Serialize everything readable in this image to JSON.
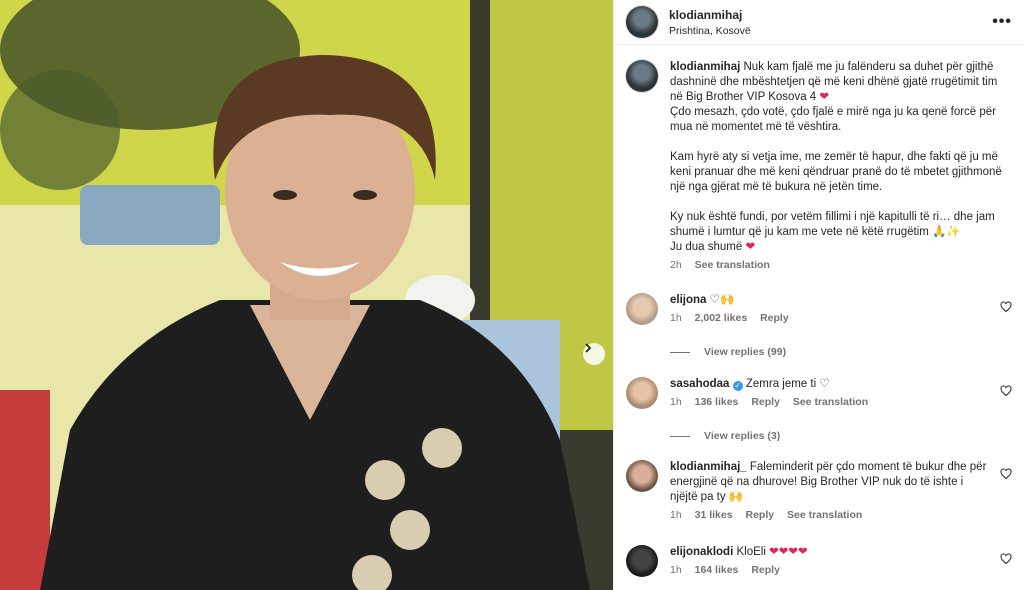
{
  "header": {
    "username": "klodianmihaj",
    "location": "Prishtina, Kosovë",
    "more_icon": "•••"
  },
  "caption": {
    "username": "klodianmihaj",
    "line1": "Nuk kam fjalë me ju falënderu sa duhet për gjithë dashninë dhe mbështetjen që më keni dhënë gjatë rrugëtimit tim në Big Brother VIP Kosova 4",
    "line2": "Çdo mesazh, çdo votë, çdo fjalë e mirë nga ju ka qenë forcë për mua në momentet më të vështira.",
    "line3": "Kam hyrë aty si vetja ime, me zemër të hapur, dhe fakti që ju më keni pranuar dhe më keni qëndruar pranë do të mbetet gjithmonë një nga gjërat më të bukura në jetën time.",
    "line4": "Ky nuk është fundi, por vetëm fillimi i një kapitulli të ri… dhe jam shumë i lumtur që ju kam me vete në këtë rrugëtim",
    "line5": "Ju dua shumë",
    "time": "2h",
    "see_translation": "See translation"
  },
  "comments": [
    {
      "username": "elijona",
      "text": "",
      "time": "1h",
      "likes": "2,002 likes",
      "reply": "Reply",
      "see_translation": "",
      "view_replies": "View replies (99)"
    },
    {
      "username": "sasahodaa",
      "text": "Zemra jeme ti",
      "time": "1h",
      "likes": "136 likes",
      "reply": "Reply",
      "see_translation": "See translation",
      "view_replies": "View replies (3)"
    },
    {
      "username": "klodianmihaj_",
      "text": "Faleminderit për çdo moment të bukur dhe për energjinë që na dhurove! Big Brother VIP nuk do të ishte i njëjtë pa ty",
      "time": "1h",
      "likes": "31 likes",
      "reply": "Reply",
      "see_translation": "See translation",
      "view_replies": ""
    },
    {
      "username": "elijonaklodi",
      "text": "KloEli",
      "time": "1h",
      "likes": "164 likes",
      "reply": "Reply",
      "see_translation": "",
      "view_replies": ""
    }
  ],
  "colors": {
    "accent_red": "#e0245e",
    "verified_blue": "#3897f0",
    "muted": "#737373"
  },
  "icons": [
    "more-icon",
    "next-arrow-icon",
    "heart-outline-icon",
    "heart-red-icon",
    "verified-icon"
  ]
}
